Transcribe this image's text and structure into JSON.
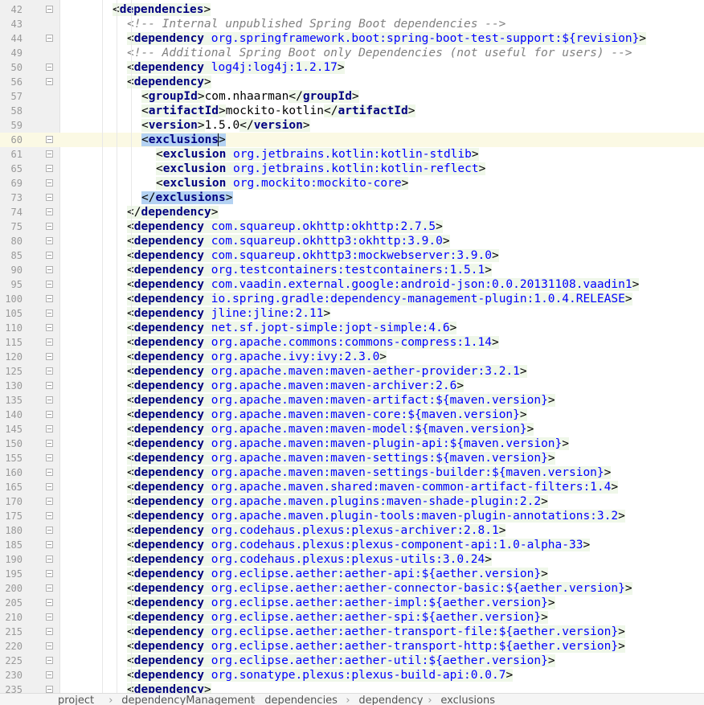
{
  "editor": {
    "lines": [
      {
        "n": "42",
        "indent": 8,
        "fold": true,
        "type": "open",
        "tag": "dependencies"
      },
      {
        "n": "43",
        "indent": 10,
        "type": "comment",
        "text": "<!-- Internal unpublished Spring Boot dependencies -->"
      },
      {
        "n": "44",
        "indent": 10,
        "fold": true,
        "type": "dep",
        "value": "org.springframework.boot:spring-boot-test-support:${revision}"
      },
      {
        "n": "49",
        "indent": 10,
        "type": "comment",
        "text": "<!-- Additional Spring Boot only Dependencies (not useful for users) -->"
      },
      {
        "n": "50",
        "indent": 10,
        "fold": true,
        "type": "dep",
        "value": "log4j:log4j:1.2.17"
      },
      {
        "n": "56",
        "indent": 10,
        "fold": true,
        "type": "open",
        "tag": "dependency"
      },
      {
        "n": "57",
        "indent": 12,
        "type": "elem",
        "tag": "groupId",
        "text": "com.nhaarman"
      },
      {
        "n": "58",
        "indent": 12,
        "type": "elem",
        "tag": "artifactId",
        "text": "mockito-kotlin"
      },
      {
        "n": "59",
        "indent": 12,
        "type": "elem",
        "tag": "version",
        "text": "1.5.0"
      },
      {
        "n": "60",
        "indent": 12,
        "fold": true,
        "type": "open",
        "tag": "exclusions",
        "current": true,
        "highlight": true
      },
      {
        "n": "61",
        "indent": 14,
        "fold": true,
        "type": "excl",
        "value": "org.jetbrains.kotlin:kotlin-stdlib"
      },
      {
        "n": "65",
        "indent": 14,
        "fold": true,
        "type": "excl",
        "value": "org.jetbrains.kotlin:kotlin-reflect"
      },
      {
        "n": "69",
        "indent": 14,
        "fold": true,
        "type": "excl",
        "value": "org.mockito:mockito-core"
      },
      {
        "n": "73",
        "indent": 12,
        "fold": true,
        "type": "close",
        "tag": "exclusions",
        "highlight": true
      },
      {
        "n": "74",
        "indent": 10,
        "fold": true,
        "type": "close",
        "tag": "dependency"
      },
      {
        "n": "75",
        "indent": 10,
        "fold": true,
        "type": "dep",
        "value": "com.squareup.okhttp:okhttp:2.7.5"
      },
      {
        "n": "80",
        "indent": 10,
        "fold": true,
        "type": "dep",
        "value": "com.squareup.okhttp3:okhttp:3.9.0"
      },
      {
        "n": "85",
        "indent": 10,
        "fold": true,
        "type": "dep",
        "value": "com.squareup.okhttp3:mockwebserver:3.9.0"
      },
      {
        "n": "90",
        "indent": 10,
        "fold": true,
        "type": "dep",
        "value": "org.testcontainers:testcontainers:1.5.1"
      },
      {
        "n": "95",
        "indent": 10,
        "fold": true,
        "type": "dep",
        "value": "com.vaadin.external.google:android-json:0.0.20131108.vaadin1"
      },
      {
        "n": "100",
        "indent": 10,
        "fold": true,
        "type": "dep",
        "value": "io.spring.gradle:dependency-management-plugin:1.0.4.RELEASE"
      },
      {
        "n": "105",
        "indent": 10,
        "fold": true,
        "type": "dep",
        "value": "jline:jline:2.11"
      },
      {
        "n": "110",
        "indent": 10,
        "fold": true,
        "type": "dep",
        "value": "net.sf.jopt-simple:jopt-simple:4.6"
      },
      {
        "n": "115",
        "indent": 10,
        "fold": true,
        "type": "dep",
        "value": "org.apache.commons:commons-compress:1.14"
      },
      {
        "n": "120",
        "indent": 10,
        "fold": true,
        "type": "dep",
        "value": "org.apache.ivy:ivy:2.3.0"
      },
      {
        "n": "125",
        "indent": 10,
        "fold": true,
        "type": "dep",
        "value": "org.apache.maven:maven-aether-provider:3.2.1"
      },
      {
        "n": "130",
        "indent": 10,
        "fold": true,
        "type": "dep",
        "value": "org.apache.maven:maven-archiver:2.6"
      },
      {
        "n": "135",
        "indent": 10,
        "fold": true,
        "type": "dep",
        "value": "org.apache.maven:maven-artifact:${maven.version}"
      },
      {
        "n": "140",
        "indent": 10,
        "fold": true,
        "type": "dep",
        "value": "org.apache.maven:maven-core:${maven.version}"
      },
      {
        "n": "145",
        "indent": 10,
        "fold": true,
        "type": "dep",
        "value": "org.apache.maven:maven-model:${maven.version}"
      },
      {
        "n": "150",
        "indent": 10,
        "fold": true,
        "type": "dep",
        "value": "org.apache.maven:maven-plugin-api:${maven.version}"
      },
      {
        "n": "155",
        "indent": 10,
        "fold": true,
        "type": "dep",
        "value": "org.apache.maven:maven-settings:${maven.version}"
      },
      {
        "n": "160",
        "indent": 10,
        "fold": true,
        "type": "dep",
        "value": "org.apache.maven:maven-settings-builder:${maven.version}"
      },
      {
        "n": "165",
        "indent": 10,
        "fold": true,
        "type": "dep",
        "value": "org.apache.maven.shared:maven-common-artifact-filters:1.4"
      },
      {
        "n": "170",
        "indent": 10,
        "fold": true,
        "type": "dep",
        "value": "org.apache.maven.plugins:maven-shade-plugin:2.2"
      },
      {
        "n": "175",
        "indent": 10,
        "fold": true,
        "type": "dep",
        "value": "org.apache.maven.plugin-tools:maven-plugin-annotations:3.2"
      },
      {
        "n": "180",
        "indent": 10,
        "fold": true,
        "type": "dep",
        "value": "org.codehaus.plexus:plexus-archiver:2.8.1"
      },
      {
        "n": "185",
        "indent": 10,
        "fold": true,
        "type": "dep",
        "value": "org.codehaus.plexus:plexus-component-api:1.0-alpha-33"
      },
      {
        "n": "190",
        "indent": 10,
        "fold": true,
        "type": "dep",
        "value": "org.codehaus.plexus:plexus-utils:3.0.24"
      },
      {
        "n": "195",
        "indent": 10,
        "fold": true,
        "type": "dep",
        "value": "org.eclipse.aether:aether-api:${aether.version}"
      },
      {
        "n": "200",
        "indent": 10,
        "fold": true,
        "type": "dep",
        "value": "org.eclipse.aether:aether-connector-basic:${aether.version}"
      },
      {
        "n": "205",
        "indent": 10,
        "fold": true,
        "type": "dep",
        "value": "org.eclipse.aether:aether-impl:${aether.version}"
      },
      {
        "n": "210",
        "indent": 10,
        "fold": true,
        "type": "dep",
        "value": "org.eclipse.aether:aether-spi:${aether.version}"
      },
      {
        "n": "215",
        "indent": 10,
        "fold": true,
        "type": "dep",
        "value": "org.eclipse.aether:aether-transport-file:${aether.version}"
      },
      {
        "n": "220",
        "indent": 10,
        "fold": true,
        "type": "dep",
        "value": "org.eclipse.aether:aether-transport-http:${aether.version}"
      },
      {
        "n": "225",
        "indent": 10,
        "fold": true,
        "type": "dep",
        "value": "org.eclipse.aether:aether-util:${aether.version}"
      },
      {
        "n": "230",
        "indent": 10,
        "fold": true,
        "type": "dep",
        "value": "org.sonatype.plexus:plexus-build-api:0.0.7"
      },
      {
        "n": "235",
        "indent": 10,
        "fold": true,
        "type": "open",
        "tag": "dependency"
      }
    ]
  },
  "breadcrumbs": [
    "project",
    "dependencyManagement",
    "dependencies",
    "dependency",
    "exclusions"
  ],
  "colors": {
    "tag": "#000080",
    "attr": "#0000ff",
    "comment": "#808080",
    "tag_bg": "#eff7e9",
    "selection": "#b4d2f2",
    "current_line": "#fbf9e4"
  }
}
